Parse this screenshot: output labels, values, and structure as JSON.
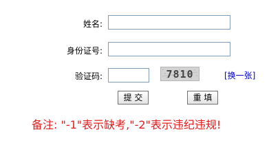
{
  "form": {
    "name_label": "姓名:",
    "name_value": "",
    "id_label": "身份证号:",
    "id_value": "",
    "captcha_label": "验证码:",
    "captcha_value": "",
    "captcha_image_text": "7810",
    "refresh_link": "[换一张]",
    "submit_label": "提 交",
    "reset_label": "重 填"
  },
  "note": {
    "text": "备注: \"-1\"表示缺考,\"-2\"表示违纪违规!"
  },
  "colors": {
    "note_text": "#e02020",
    "link": "#0000cc",
    "field_border": "#7f9db9"
  },
  "icons": {
    "captcha": "captcha-image"
  }
}
